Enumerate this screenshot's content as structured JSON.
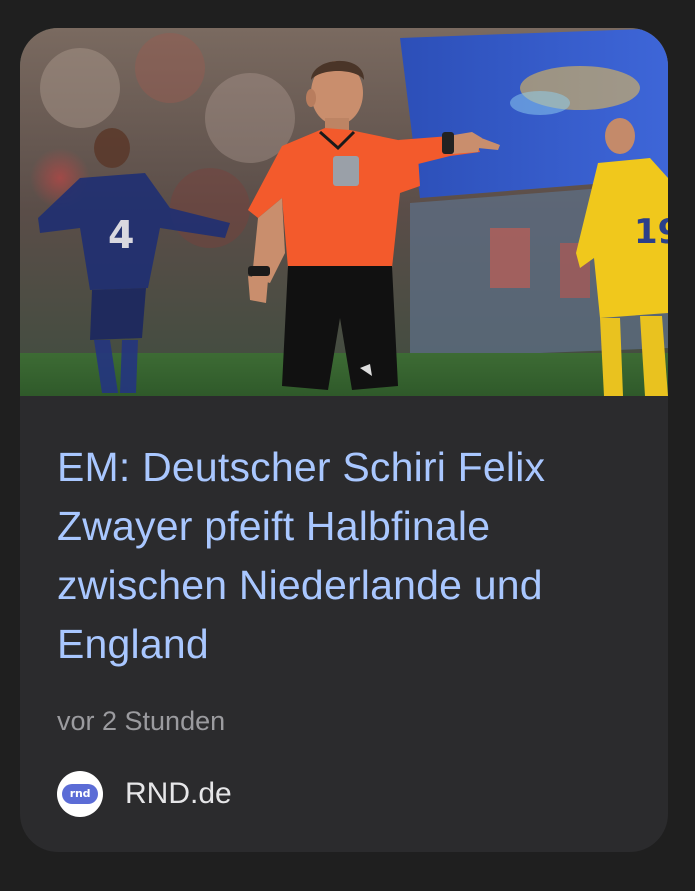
{
  "card": {
    "image": {
      "alt_subject": "referee-photo"
    },
    "headline": "EM: Deutscher Schiri Felix Zwayer pfeift Halbfinale zwischen Niederlande und England",
    "time": "vor 2 Stunden",
    "source": {
      "logo_text": "rnd",
      "name": "RND.de"
    }
  },
  "colors": {
    "background": "#1f1f1f",
    "card": "#2b2b2d",
    "headline": "#a9c7ff",
    "meta": "#9b9b9f",
    "source": "#e6e6e8"
  }
}
